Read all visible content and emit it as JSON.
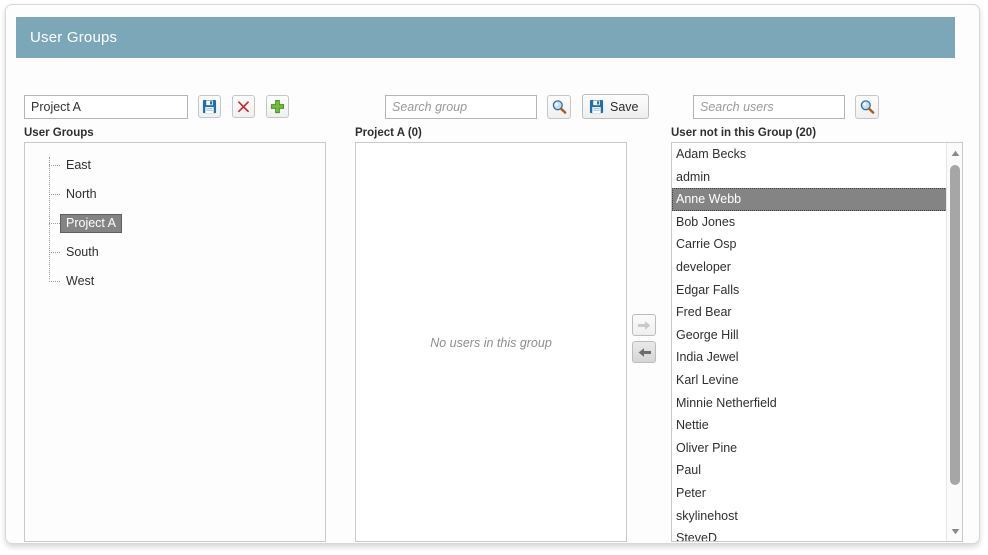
{
  "window": {
    "title": "User Groups"
  },
  "toolbar": {
    "group_name_value": "Project A",
    "group_name_placeholder": "",
    "save_icon_title": "Save",
    "delete_icon_title": "Delete",
    "add_icon_title": "Add",
    "search_group_placeholder": "Search group",
    "search_group_value": "",
    "search_group_button_title": "Search",
    "save_button_label": "Save",
    "search_users_placeholder": "Search users",
    "search_users_value": "",
    "search_users_button_title": "Search"
  },
  "colors": {
    "header_bg": "#7ba7b8",
    "selection_bg": "#848484",
    "selection_text": "#ffffff",
    "save_icon": "#1f6fa8",
    "delete_icon": "#d42020",
    "add_icon": "#6cc03a",
    "magnifier_lens": "#8fc4e8",
    "magnifier_handle": "#b05a12"
  },
  "tree": {
    "label": "User Groups",
    "selected": "Project A",
    "nodes": [
      {
        "label": "East"
      },
      {
        "label": "North"
      },
      {
        "label": "Project A"
      },
      {
        "label": "South"
      },
      {
        "label": "West"
      }
    ]
  },
  "members": {
    "label": "Project A (0)",
    "count": 0,
    "empty_message": "No users in this group",
    "items": []
  },
  "available_users": {
    "label": "User not in this Group (20)",
    "count": 20,
    "selected": "Anne Webb",
    "items": [
      {
        "name": "Adam Becks"
      },
      {
        "name": "admin"
      },
      {
        "name": "Anne Webb"
      },
      {
        "name": "Bob Jones"
      },
      {
        "name": "Carrie Osp"
      },
      {
        "name": "developer"
      },
      {
        "name": "Edgar Falls"
      },
      {
        "name": "Fred Bear"
      },
      {
        "name": "George Hill"
      },
      {
        "name": "India Jewel"
      },
      {
        "name": "Karl Levine"
      },
      {
        "name": "Minnie Netherfield"
      },
      {
        "name": "Nettie"
      },
      {
        "name": "Oliver Pine"
      },
      {
        "name": "Paul"
      },
      {
        "name": "Peter"
      },
      {
        "name": "skylinehost"
      },
      {
        "name": "SteveD"
      }
    ]
  },
  "transfer": {
    "move_right_title": "Add selected user to group",
    "move_left_title": "Remove selected user from group"
  }
}
